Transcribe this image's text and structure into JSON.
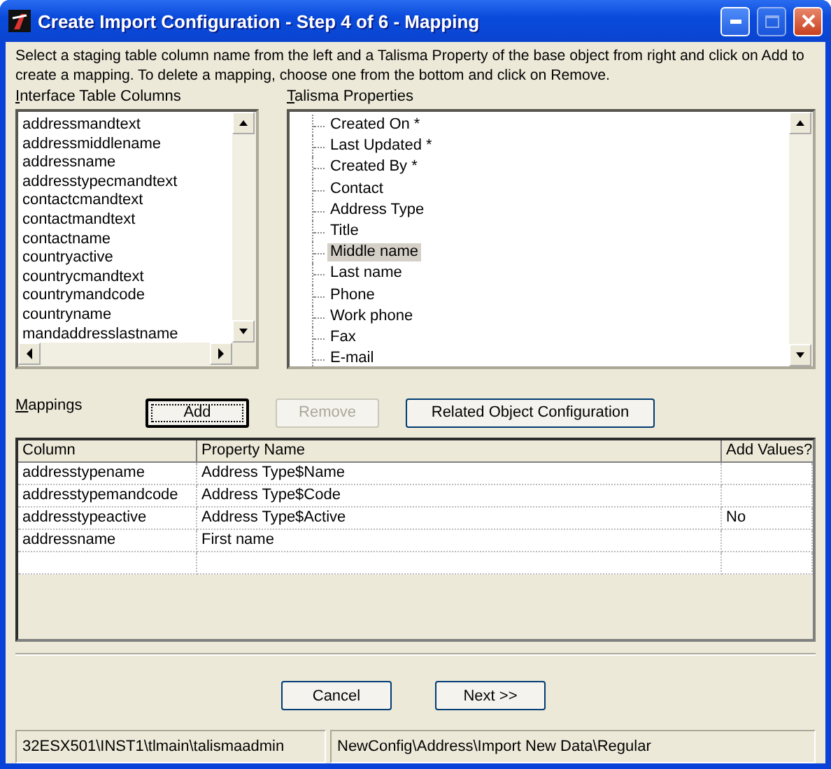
{
  "window": {
    "title": "Create Import Configuration - Step 4 of 6 - Mapping"
  },
  "instructions": "Select a staging table column name from the left and a Talisma Property of the base object from right and click on Add to create a mapping. To delete a mapping, choose one from the bottom and click on Remove.",
  "columns_list": {
    "label": "Interface Table Columns",
    "items": [
      {
        "text": "addressmandtext",
        "selected": false
      },
      {
        "text": "addressmiddlename",
        "selected": false
      },
      {
        "text": "addressname",
        "selected": false
      },
      {
        "text": "addresstypecmandtext",
        "selected": false
      },
      {
        "text": "contactcmandtext",
        "selected": false
      },
      {
        "text": "contactmandtext",
        "selected": false
      },
      {
        "text": "contactname",
        "selected": false
      },
      {
        "text": "countryactive",
        "selected": false
      },
      {
        "text": "countrycmandtext",
        "selected": false
      },
      {
        "text": "countrymandcode",
        "selected": false
      },
      {
        "text": "countryname",
        "selected": false
      },
      {
        "text": "mandaddresslastname",
        "selected": false
      }
    ]
  },
  "properties_tree": {
    "label": "Talisma Properties",
    "items": [
      {
        "text": "Created On *",
        "selected": false
      },
      {
        "text": "Last Updated *",
        "selected": false
      },
      {
        "text": "Created By *",
        "selected": false
      },
      {
        "text": "Contact",
        "selected": false
      },
      {
        "text": "Address Type",
        "selected": false
      },
      {
        "text": "Title",
        "selected": false
      },
      {
        "text": "Middle name",
        "selected": true
      },
      {
        "text": "Last name",
        "selected": false
      },
      {
        "text": "Phone",
        "selected": false
      },
      {
        "text": "Work phone",
        "selected": false
      },
      {
        "text": "Fax",
        "selected": false
      },
      {
        "text": "E-mail",
        "selected": false
      }
    ]
  },
  "mappings": {
    "label": "Mappings",
    "buttons": [
      {
        "label": "Add",
        "disabled": false,
        "focused": true
      },
      {
        "label": "Remove",
        "disabled": true,
        "focused": false
      },
      {
        "label": "Related Object Configuration",
        "disabled": false,
        "focused": false
      }
    ],
    "table": {
      "columns": [
        "Column",
        "Property Name",
        "Add Values?"
      ],
      "rows": [
        [
          "addresstypename",
          "Address Type$Name",
          ""
        ],
        [
          "addresstypemandcode",
          "Address Type$Code",
          ""
        ],
        [
          "addresstypeactive",
          "Address Type$Active",
          "No"
        ],
        [
          "addressname",
          "First name",
          ""
        ]
      ]
    }
  },
  "footer_buttons": [
    {
      "label": "Cancel"
    },
    {
      "label": "Next >>"
    }
  ],
  "status_bar": [
    "32ESX501\\INST1\\tlmain\\talismaadmin",
    "NewConfig\\Address\\Import New Data\\Regular"
  ]
}
